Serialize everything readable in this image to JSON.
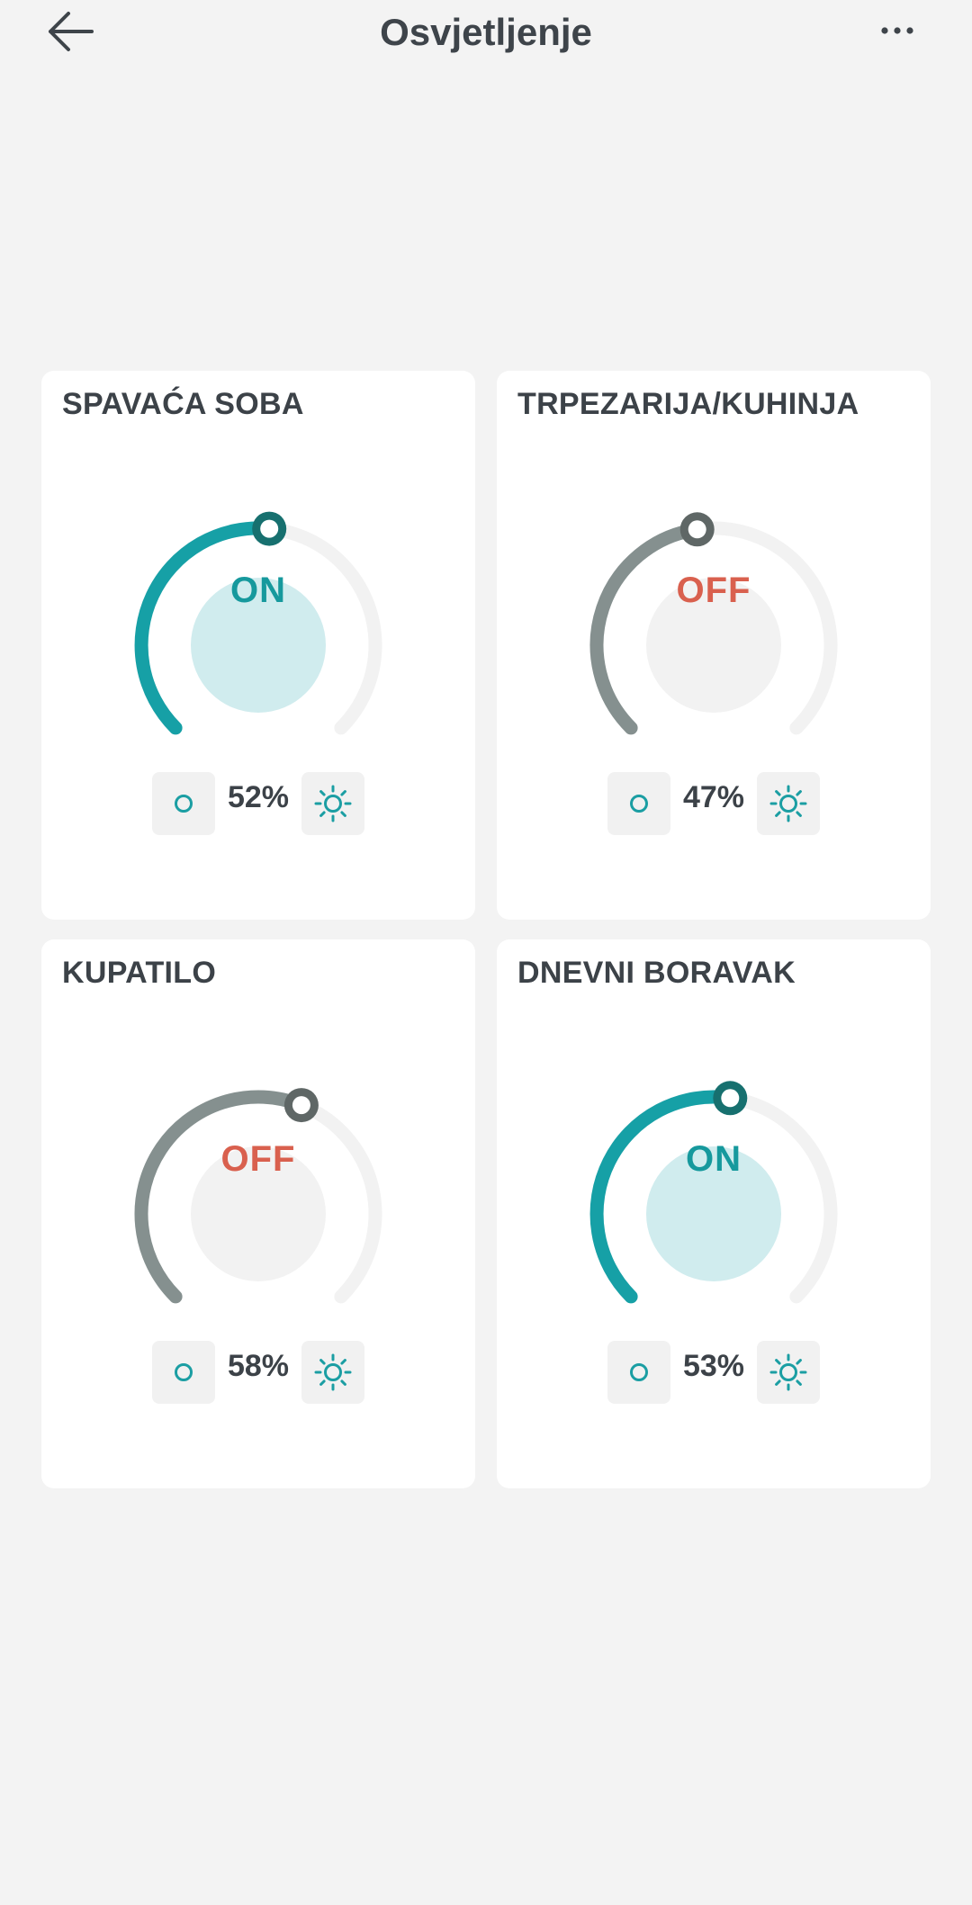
{
  "header": {
    "title": "Osvjetljenje",
    "back_icon": "arrow-left-icon",
    "menu_icon": "more-horizontal-icon"
  },
  "colors": {
    "on_arc": "#16a0a6",
    "on_knob": "#17706f",
    "off_arc": "#85908f",
    "off_knob": "#5f6766",
    "track": "#f2f2f2",
    "on_center": "#d0ecee",
    "off_center": "#f2f2f2",
    "on_text": "#16999d",
    "off_text": "#d9604e",
    "icon": "#1b9ea3"
  },
  "rooms": [
    {
      "name": "SPAVAĆA SOBA",
      "state": "ON",
      "brightness": "52%",
      "level": 0.52
    },
    {
      "name": "TRPEZARIJA/KUHINJA",
      "state": "OFF",
      "brightness": "47%",
      "level": 0.47
    },
    {
      "name": "KUPATILO",
      "state": "OFF",
      "brightness": "58%",
      "level": 0.58
    },
    {
      "name": "DNEVNI BORAVAK",
      "state": "ON",
      "brightness": "53%",
      "level": 0.53
    }
  ],
  "controls": {
    "dim_icon": "circle-dim-icon",
    "bright_icon": "sun-icon"
  }
}
